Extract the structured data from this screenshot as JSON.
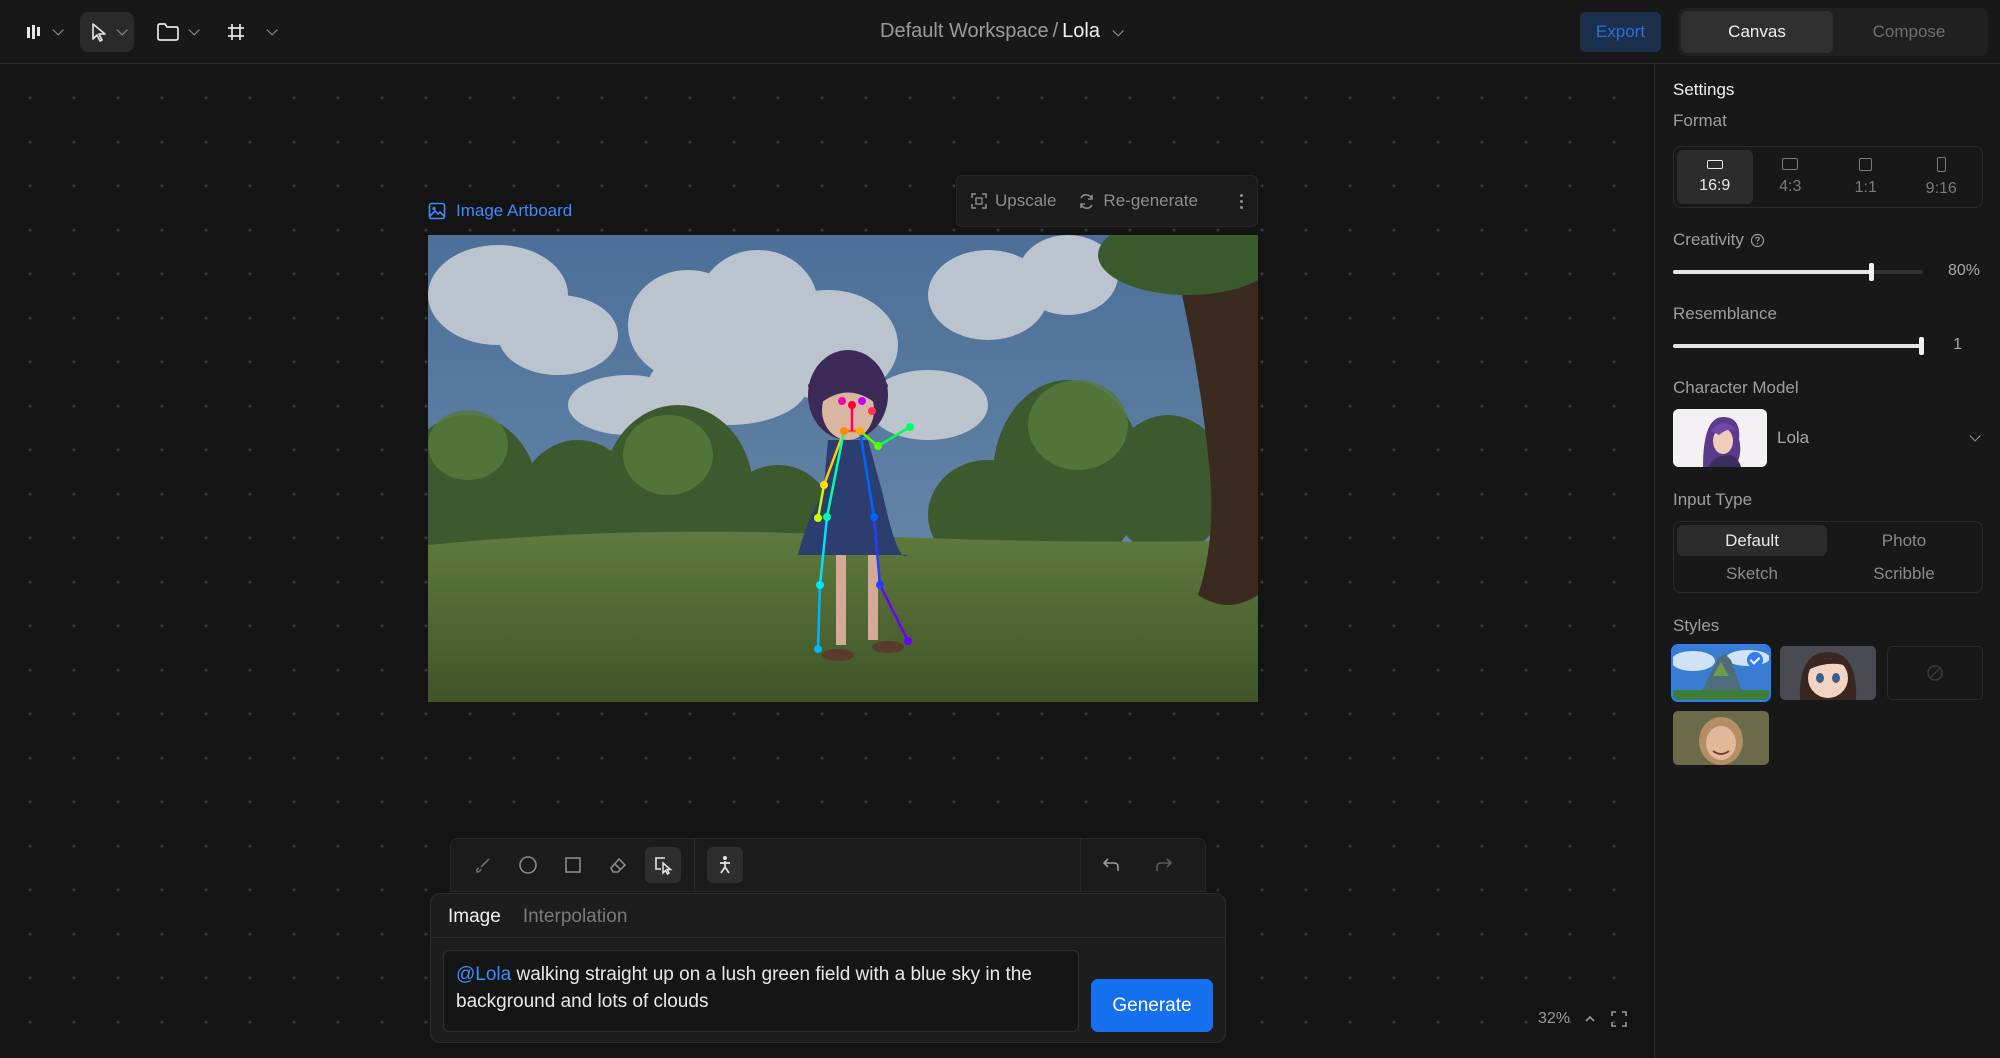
{
  "topbar": {
    "breadcrumb_workspace": "Default Workspace",
    "breadcrumb_sep": "/",
    "breadcrumb_current": "Lola",
    "export_label": "Export",
    "view_tabs": [
      "Canvas",
      "Compose"
    ],
    "active_view": "Canvas"
  },
  "canvas": {
    "artboard_label": "Image Artboard",
    "toolbar": {
      "upscale": "Upscale",
      "regenerate": "Re-generate"
    },
    "zoom": "32%"
  },
  "prompt": {
    "tabs": [
      "Image",
      "Interpolation"
    ],
    "active_tab": "Image",
    "mention": "@Lola",
    "text": " walking straight up on a lush green field with a blue sky in the background and lots of clouds",
    "generate_label": "Generate"
  },
  "settings": {
    "title": "Settings",
    "format_label": "Format",
    "formats": [
      "16:9",
      "4:3",
      "1:1",
      "9:16"
    ],
    "active_format": "16:9",
    "creativity_label": "Creativity",
    "creativity_value": "80%",
    "creativity_fraction": 0.8,
    "resemblance_label": "Resemblance",
    "resemblance_value": "1",
    "resemblance_fraction": 1.0,
    "character_label": "Character Model",
    "character_name": "Lola",
    "input_type_label": "Input Type",
    "input_types": [
      "Default",
      "Photo",
      "Sketch",
      "Scribble"
    ],
    "active_input_type": "Default",
    "styles_label": "Styles"
  },
  "colors": {
    "accent": "#1570ef",
    "mention": "#3d8bfd",
    "export_bg": "#1c2f4d"
  }
}
